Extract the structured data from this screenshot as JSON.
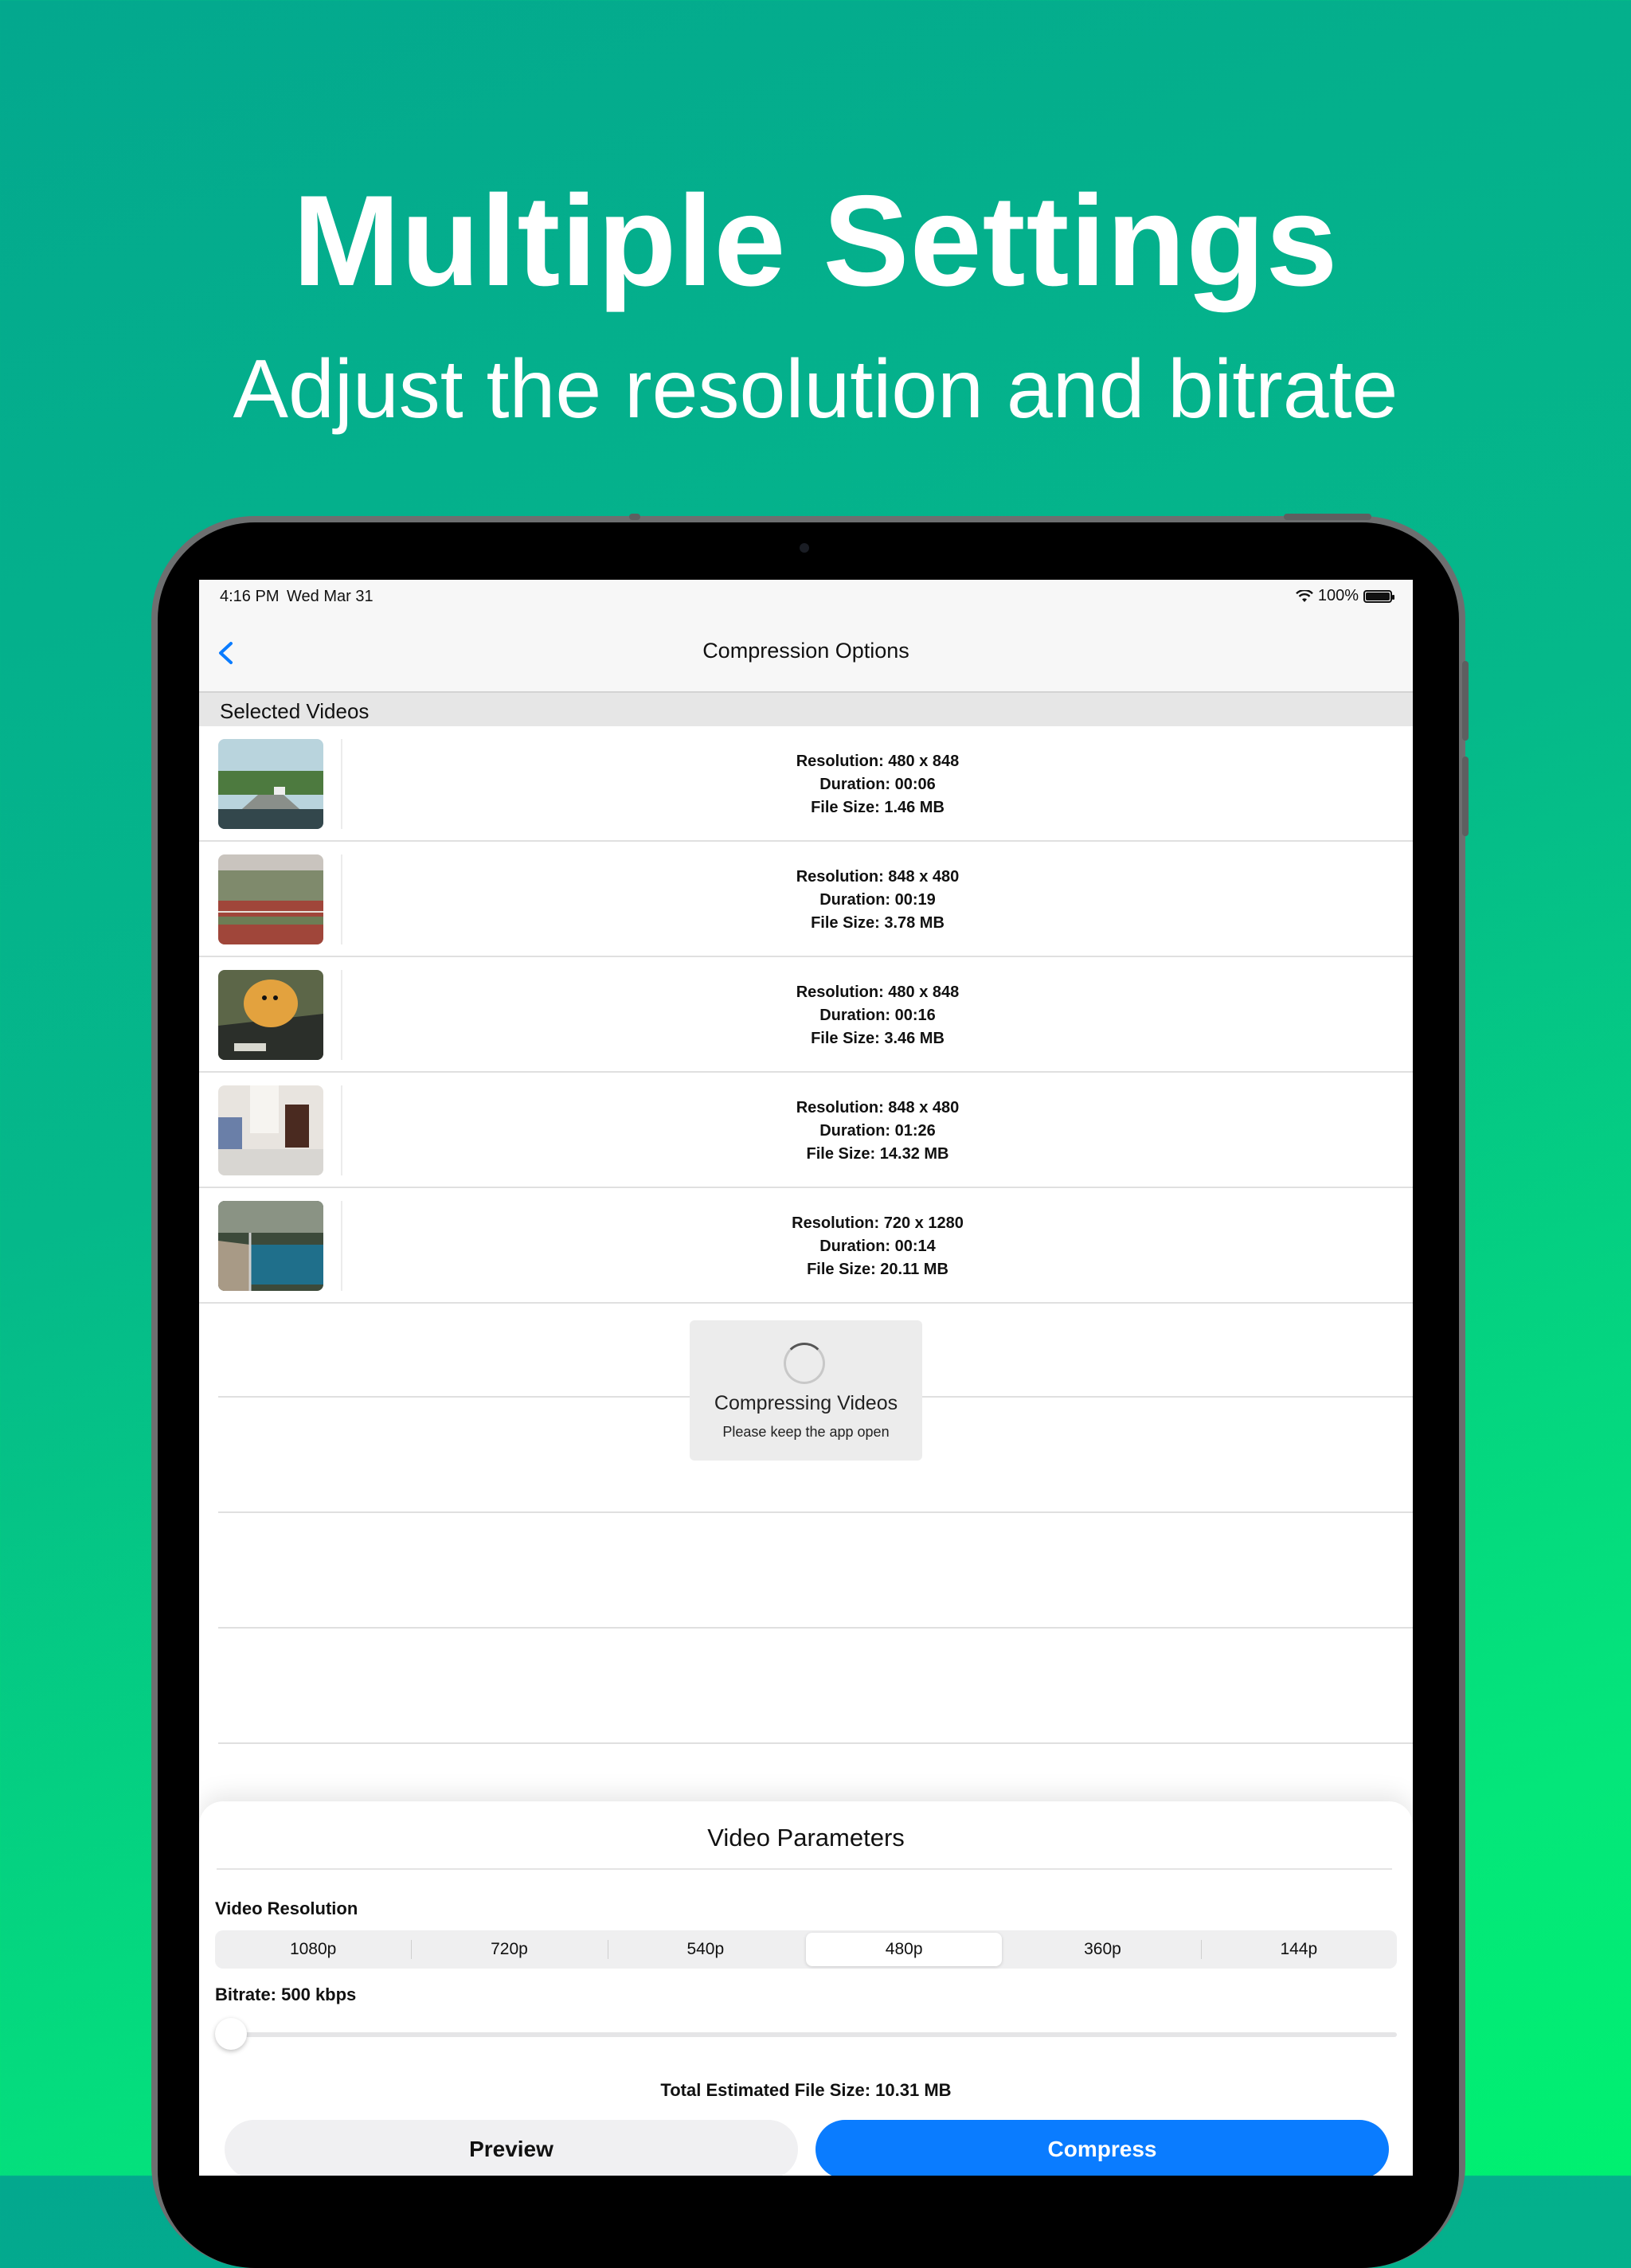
{
  "promo": {
    "headline": "Multiple Settings",
    "subheadline": "Adjust the resolution and bitrate"
  },
  "status_bar": {
    "time": "4:16 PM",
    "date": "Wed Mar 31",
    "battery": "100%"
  },
  "nav": {
    "title": "Compression Options",
    "back_icon": "chevron-left-icon"
  },
  "section": {
    "title": "Selected Videos"
  },
  "videos": [
    {
      "resolution": "Resolution: 480 x 848",
      "duration": "Duration: 00:06",
      "size": "File Size: 1.46 MB"
    },
    {
      "resolution": "Resolution: 848 x 480",
      "duration": "Duration: 00:19",
      "size": "File Size: 3.78 MB"
    },
    {
      "resolution": "Resolution: 480 x 848",
      "duration": "Duration: 00:16",
      "size": "File Size: 3.46 MB"
    },
    {
      "resolution": "Resolution: 848 x 480",
      "duration": "Duration: 01:26",
      "size": "File Size: 14.32 MB"
    },
    {
      "resolution": "Resolution: 720 x 1280",
      "duration": "Duration: 00:14",
      "size": "File Size: 20.11 MB"
    }
  ],
  "loader": {
    "title": "Compressing Videos",
    "message": "Please keep the app open"
  },
  "params": {
    "title": "Video Parameters",
    "resolution_label": "Video Resolution",
    "resolutions": [
      "1080p",
      "720p",
      "540p",
      "480p",
      "360p",
      "144p"
    ],
    "selected_resolution": "480p",
    "bitrate_label": "Bitrate: 500 kbps",
    "bitrate_slider_fraction": 0.0,
    "total_size": "Total Estimated File Size: 10.31 MB",
    "preview_label": "Preview",
    "compress_label": "Compress"
  },
  "colors": {
    "accent": "#0a7cff",
    "background_start": "#03a88e",
    "background_end": "#00f070"
  }
}
